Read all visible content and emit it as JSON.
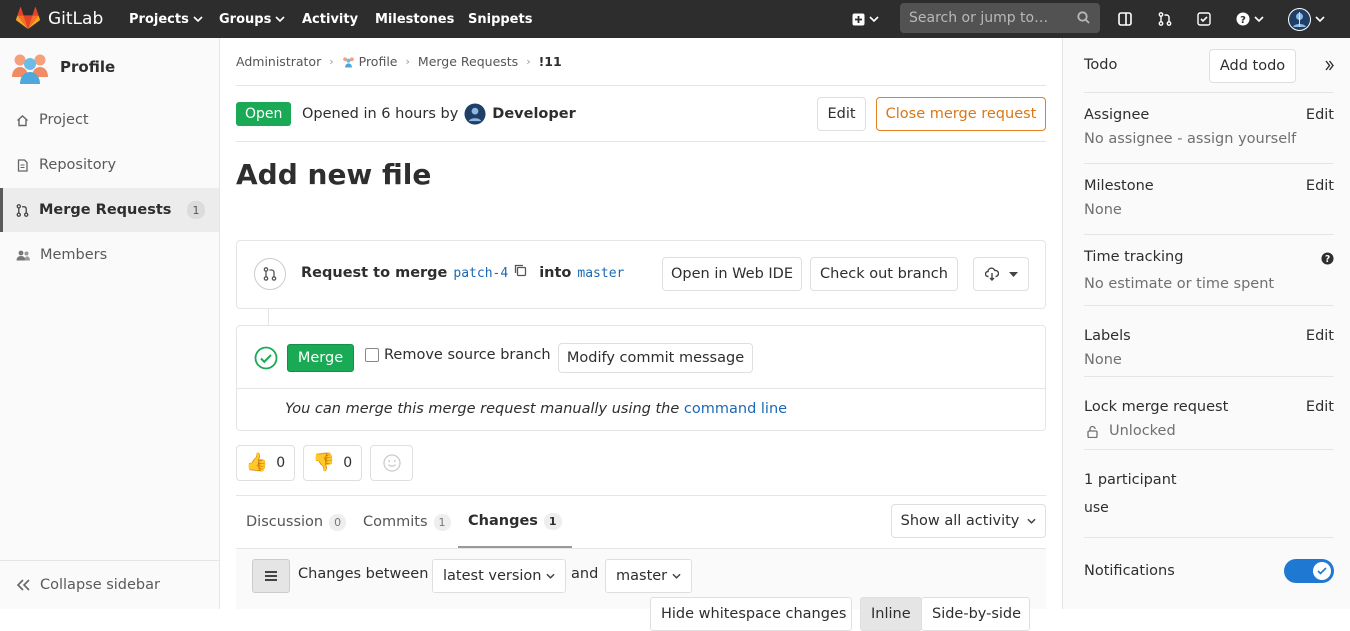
{
  "navbar": {
    "brand": "GitLab",
    "items": [
      {
        "label": "Projects",
        "dropdown": true
      },
      {
        "label": "Groups",
        "dropdown": true
      },
      {
        "label": "Activity",
        "dropdown": false
      },
      {
        "label": "Milestones",
        "dropdown": false
      },
      {
        "label": "Snippets",
        "dropdown": false
      }
    ],
    "search_placeholder": "Search or jump to…",
    "icons": [
      "plus-square-icon",
      "sidebar-panel-icon",
      "merge-request-icon",
      "todo-check-icon",
      "help-icon",
      "user-avatar"
    ]
  },
  "left_sidebar": {
    "title": "Profile",
    "items": [
      {
        "label": "Project",
        "icon": "home-icon"
      },
      {
        "label": "Repository",
        "icon": "document-icon"
      },
      {
        "label": "Merge Requests",
        "icon": "merge-request-icon",
        "count": "1",
        "active": true
      },
      {
        "label": "Members",
        "icon": "users-icon"
      }
    ],
    "collapse": "Collapse sidebar"
  },
  "breadcrumb": [
    "Administrator",
    "Profile",
    "Merge Requests",
    "!11"
  ],
  "mr": {
    "status": "Open",
    "opened_text": "Opened in 6 hours by",
    "author": "Developer",
    "edit_label": "Edit",
    "close_label": "Close merge request",
    "title": "Add new file",
    "request_to_merge": "Request to merge",
    "source_branch": "patch-4",
    "into": "into",
    "target_branch": "master",
    "web_ide": "Open in Web IDE",
    "checkout": "Check out branch",
    "merge_label": "Merge",
    "remove_source": "Remove source branch",
    "modify_commit": "Modify commit message",
    "manual_text": "You can merge this merge request manually using the",
    "command_line": "command line"
  },
  "awards": {
    "thumbsup": "0",
    "thumbsdown": "0"
  },
  "tabs": [
    {
      "label": "Discussion",
      "count": "0"
    },
    {
      "label": "Commits",
      "count": "1"
    },
    {
      "label": "Changes",
      "count": "1",
      "active": true
    }
  ],
  "activity_filter": "Show all activity",
  "changes": {
    "between": "Changes between",
    "from": "latest version",
    "and": "and",
    "to": "master",
    "whitespace": "Hide whitespace changes",
    "inline": "Inline",
    "side_by_side": "Side-by-side"
  },
  "right_sidebar": {
    "todo": "Todo",
    "add_todo": "Add todo",
    "assignee": "Assignee",
    "assignee_value": "No assignee - assign yourself",
    "milestone": "Milestone",
    "milestone_value": "None",
    "time_tracking": "Time tracking",
    "time_value": "No estimate or time spent",
    "labels": "Labels",
    "labels_value": "None",
    "lock": "Lock merge request",
    "lock_value": "Unlocked",
    "participants": "1 participant",
    "participant_name": "use",
    "notifications": "Notifications",
    "notifications_on": true,
    "edit": "Edit"
  },
  "colors": {
    "navbar": "#2d2d2d",
    "open_green": "#1aaa55",
    "link_blue": "#1b69b6",
    "warning_orange": "#e67e22",
    "toggle_blue": "#1f78d1"
  }
}
